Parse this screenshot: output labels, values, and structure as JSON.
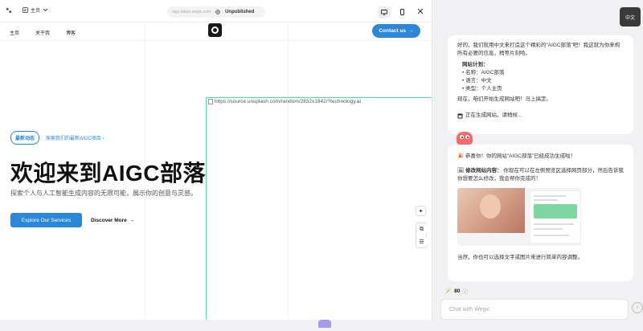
{
  "toolbar": {
    "page_label": "主页",
    "url": "aigc-buluo.wegic.com",
    "status": "Unpublished"
  },
  "site": {
    "nav": [
      "主页",
      "关于我",
      "博客"
    ],
    "contact_label": "Contact us",
    "contact_arrow": "→",
    "tag_pill": "最新动态",
    "tag_link": "探索我们的最新AIGC项目",
    "tag_arrow": "›",
    "title": "欢迎来到AIGC部落",
    "subtitle": "探索个人与人工智能生成内容的无限可能，展示你的创意与灵感。",
    "explore_label": "Explore Our Services",
    "discover_label": "Discover More",
    "discover_arrow": "→",
    "image_alt": "https://source.unsplash.com/random/2832x1842/?technology,ai"
  },
  "chat": {
    "lang_button": "中文",
    "intro": "好的，我们就用中文来打造这个精彩的“AIGC部落”吧！我这就为你来构所有必要的信息，稍等片刻哈。",
    "plan_title": "网站计划：",
    "plan_items": [
      "名称：AIGC部落",
      "语言：中文",
      "类型：个人主页"
    ],
    "start_text": "现在，咱们开始生成网站吧！马上搞定。",
    "status_text": "正在生成网站，请稍候...",
    "congrats": "恭喜你！你的网站“AIGC部落”已经成功生成啦！",
    "tip_title": "修改网站内容：",
    "tip_body": "你现在可以在左侧预览区选择网页部分，然后告诉我你想要怎么修改，我会帮你完成的！",
    "final_text": "当然，你也可以选择文字或图片来进行简单内容调整。",
    "credits": "80",
    "input_placeholder": "Chat with Wegic"
  },
  "colors": {
    "accent": "#2b87d8",
    "selection": "#5bd6a1",
    "mascot": "#f36b6b"
  }
}
